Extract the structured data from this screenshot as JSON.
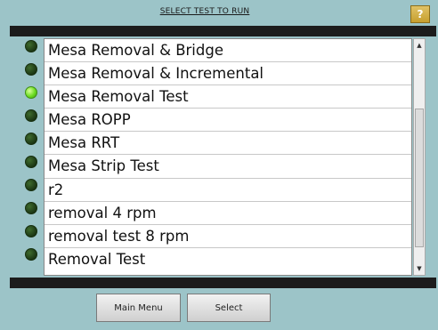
{
  "header": {
    "title": "SELECT TEST TO RUN",
    "help_label": "?"
  },
  "tests": [
    {
      "name": "Mesa Removal & Bridge",
      "active": false
    },
    {
      "name": "Mesa Removal & Incremental",
      "active": false
    },
    {
      "name": "Mesa Removal Test",
      "active": true
    },
    {
      "name": "Mesa ROPP",
      "active": false
    },
    {
      "name": "Mesa RRT",
      "active": false
    },
    {
      "name": "Mesa Strip Test",
      "active": false
    },
    {
      "name": "r2",
      "active": false
    },
    {
      "name": "removal 4 rpm",
      "active": false
    },
    {
      "name": "removal test 8 rpm",
      "active": false
    },
    {
      "name": "Removal Test",
      "active": false
    }
  ],
  "scrollbar": {
    "up_icon": "▲",
    "down_icon": "▼"
  },
  "buttons": {
    "main_menu": "Main Menu",
    "select": "Select"
  },
  "colors": {
    "background": "#9cc4c8",
    "led_on": "#6cdc22",
    "led_off": "#1e3a16"
  }
}
